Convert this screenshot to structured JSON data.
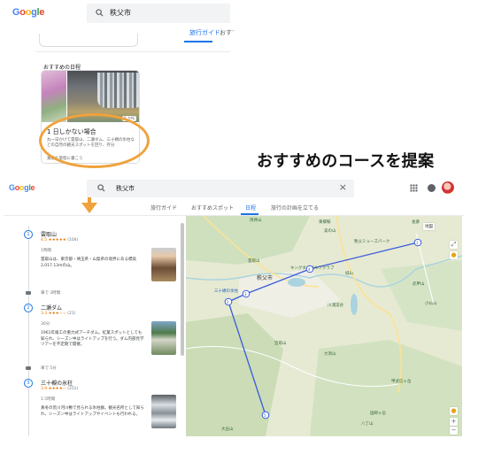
{
  "top": {
    "logo": [
      "G",
      "o",
      "o",
      "g",
      "l",
      "e"
    ],
    "search_query": "秩父市",
    "tabs": [
      "旅行ガイド",
      "おすすめスポ"
    ],
    "section_title": "おすすめの日程",
    "card": {
      "badge": "5 か所",
      "title": "1 日しかない場合",
      "description": "丸一日かけて雲取山、二瀬ダム、三十槻の氷柱などの自然の観光スポットを回り、存分",
      "footer": "素敵な旅程に書こう"
    }
  },
  "headline": "おすすめのコースを提案",
  "bottom": {
    "logo": [
      "G",
      "o",
      "o",
      "g",
      "l",
      "e"
    ],
    "search_query": "秩父市",
    "tabs": [
      "旅行ガイド",
      "おすすめスポット",
      "日程",
      "旅行の計画を立てる"
    ],
    "active_tab": "日程",
    "stops": [
      {
        "num": "1",
        "name": "雲取山",
        "rating": "4.5 ★★★★★",
        "count": "(104)",
        "duration": "1時間",
        "description": "雲取山は、東京都・埼玉県・山梨県の境界にある標高2,017.13mの山。"
      },
      {
        "num": "2",
        "name": "二瀬ダム",
        "rating": "3.3 ★★★☆☆",
        "count": "(21)",
        "duration": "30分",
        "description": "1961年竣工の重力式アーチダム。紅葉スポットとしても知られ、シーズン中はライトアップを行う。ダム内部見学ツアーを不定期で開催。"
      },
      {
        "num": "3",
        "name": "三十槻の氷柱",
        "rating": "3.9 ★★★★☆",
        "count": "(251)",
        "duration": "1.5時間",
        "description": "真冬の荒川河川敷で見られる氷柱群。観光名所として知られ、シーズン中はライトアップやイベントも行われる。"
      }
    ],
    "legs": [
      "車で 3時間",
      "車で 5分"
    ],
    "map": {
      "labels": {
        "town": "秩父市",
        "l1": "両神山",
        "l2": "秩父ミューズパーク",
        "l3": "キングダムゴルフクラブ",
        "l4": "三十槻の氷柱",
        "l5": "武甲山",
        "l6": "雲取山",
        "l7": "川浦渓谷",
        "l8": "小仏山",
        "l9": "大洞山",
        "l10": "甲武信ヶ岳",
        "l11": "国師ヶ岳",
        "l12": "笠取山",
        "l13": "大岳山",
        "l14": "美の山",
        "l15": "城山",
        "l16": "東郷鞍",
        "l17": "長瀞",
        "l18": "八丁山"
      },
      "marker_labels": [
        "1",
        "2",
        "3",
        "4",
        "5"
      ],
      "zoom_in": "+",
      "zoom_out": "−",
      "map_toggle": "地図",
      "route_color": "#3b5bdb"
    },
    "colors": {
      "accent": "#1a73e8",
      "highlight": "#f0a23c"
    }
  }
}
